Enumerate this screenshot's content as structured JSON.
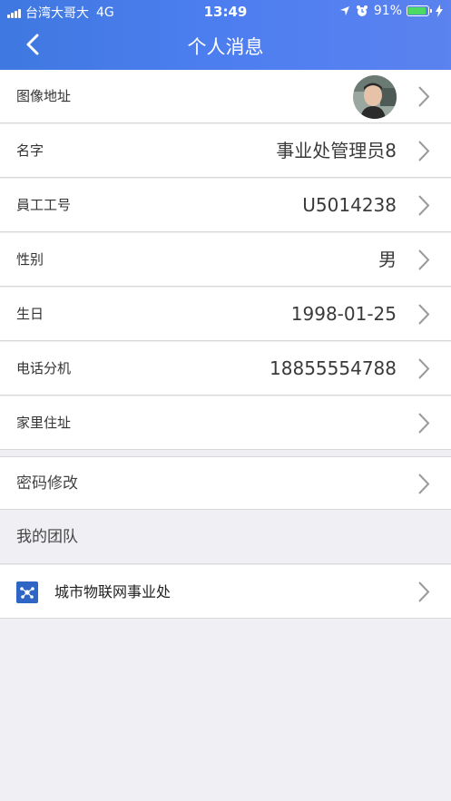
{
  "status": {
    "carrier": "台湾大哥大",
    "network": "4G",
    "time": "13:49",
    "battery": "91%"
  },
  "header": {
    "title": "个人消息"
  },
  "profile": [
    {
      "label": "图像地址",
      "value": ""
    },
    {
      "label": "名字",
      "value": "事业处管理员8"
    },
    {
      "label": "員工工号",
      "value": "U5014238"
    },
    {
      "label": "性别",
      "value": "男"
    },
    {
      "label": "生日",
      "value": "1998-01-25"
    },
    {
      "label": "电话分机",
      "value": "18855554788"
    },
    {
      "label": "家里住址",
      "value": ""
    }
  ],
  "password": {
    "label": "密码修改"
  },
  "team": {
    "section_label": "我的团队",
    "name": "城市物联网事业处"
  },
  "colors": {
    "header_start": "#3f78e0",
    "header_end": "#5b82ef",
    "background": "#efeff4",
    "battery": "#4cd964"
  }
}
